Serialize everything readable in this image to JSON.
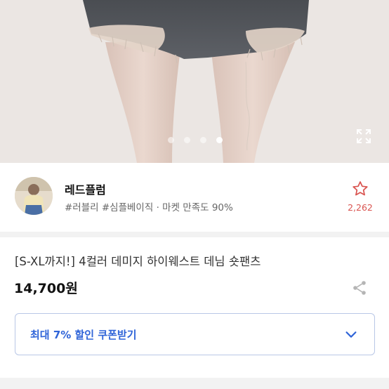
{
  "gallery": {
    "total_images": 4,
    "active_index": 4,
    "expand_icon": "expand-icon"
  },
  "shop": {
    "name": "레드플럼",
    "meta": "#러블리 #심플베이직 · 마켓 만족도 90%",
    "favorite_icon": "star-outline-icon",
    "favorite_count": "2,262",
    "accent_color": "#d9534f"
  },
  "product": {
    "title": "[S-XL까지!] 4컬러 데미지 하이웨스트 데님 숏팬츠",
    "price": "14,700원",
    "share_icon": "share-icon"
  },
  "coupon": {
    "label": "최대 7% 할인 쿠폰받기",
    "chevron_icon": "chevron-down-icon",
    "color": "#2f64d8"
  }
}
